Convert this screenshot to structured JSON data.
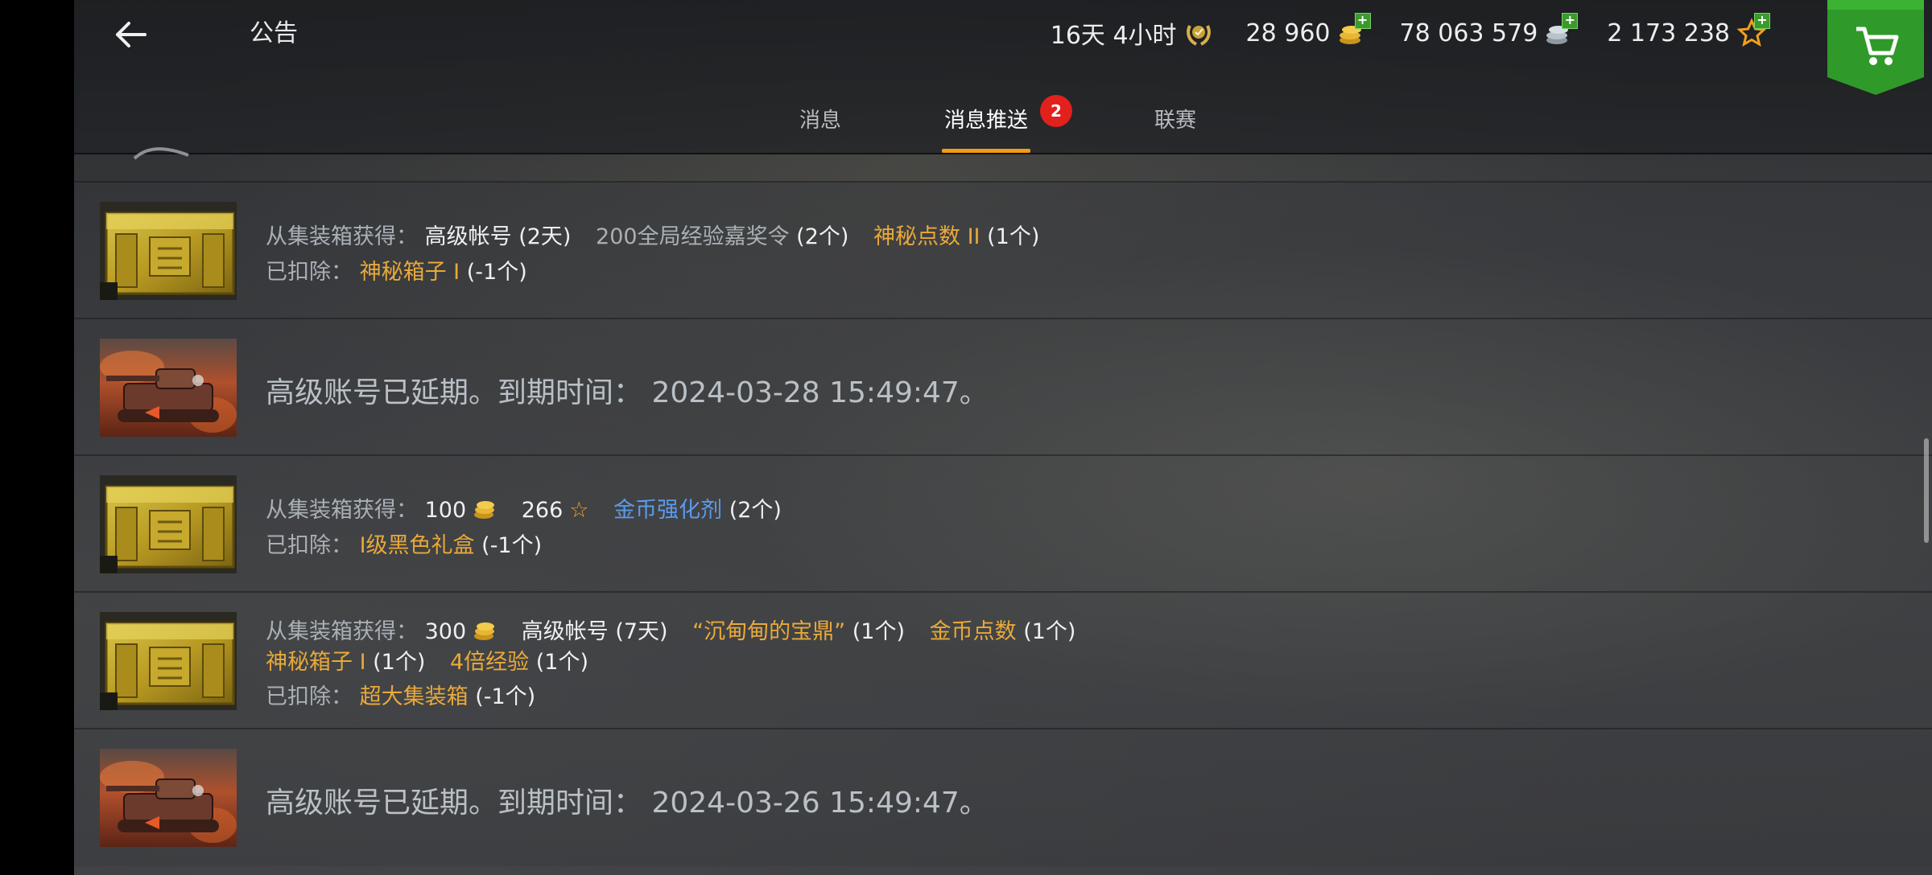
{
  "header": {
    "title": "公告",
    "resources": [
      {
        "name": "premium-time",
        "value": "16天 4小时",
        "icon": "premium-laurel-icon"
      },
      {
        "name": "gold",
        "value": "28 960",
        "icon": "gold-coins-icon"
      },
      {
        "name": "credits",
        "value": "78 063 579",
        "icon": "silver-coins-icon"
      },
      {
        "name": "free-xp",
        "value": "2 173 238",
        "icon": "star-icon"
      }
    ]
  },
  "tabs": [
    {
      "label": "消息",
      "active": false
    },
    {
      "label": "消息推送",
      "active": true,
      "badge": "2"
    },
    {
      "label": "联赛",
      "active": false
    }
  ],
  "messages": [
    {
      "type": "crate",
      "line1": {
        "prefix": "从集装箱获得：",
        "item1": "高级帐号",
        "item1_qty": "(2天)",
        "item2": "200全局经验嘉奖令",
        "item2_qty": "(2个)",
        "item3": "神秘点数 II",
        "item3_qty": "(1个)"
      },
      "line2": {
        "prefix": "已扣除：",
        "item": "神秘箱子 I",
        "qty": "(-1个)"
      }
    },
    {
      "type": "premium",
      "text": "高级账号已延期。到期时间：",
      "time": "2024-03-28 15:49:47。"
    },
    {
      "type": "crate",
      "line1": {
        "prefix": "从集装箱获得：",
        "gold": "100",
        "free_xp": "266",
        "item": "金币强化剂",
        "item_qty": "(2个)"
      },
      "line2": {
        "prefix": "已扣除：",
        "item": "I级黑色礼盒",
        "qty": "(-1个)"
      }
    },
    {
      "type": "crate",
      "line1": {
        "prefix": "从集装箱获得：",
        "gold": "300",
        "item1": "高级帐号",
        "item1_qty": "(7天)",
        "item2": "“沉甸甸的宝鼎”",
        "item2_qty": "(1个)",
        "item3": "金币点数",
        "item3_qty": "(1个)"
      },
      "line2": {
        "item1": "神秘箱子 I",
        "item1_qty": "(1个)",
        "item2": "4倍经验",
        "item2_qty": "(1个)"
      },
      "line3": {
        "prefix": "已扣除：",
        "item": "超大集装箱",
        "qty": "(-1个)"
      }
    },
    {
      "type": "premium",
      "text": "高级账号已延期。到期时间：",
      "time": "2024-03-26 15:49:47。"
    }
  ],
  "colors": {
    "accent": "#f39c12",
    "badge": "#e2201c",
    "gold_text": "#e8a93a",
    "blue_text": "#5b9bea",
    "shop_green": "#2f9a2a"
  }
}
